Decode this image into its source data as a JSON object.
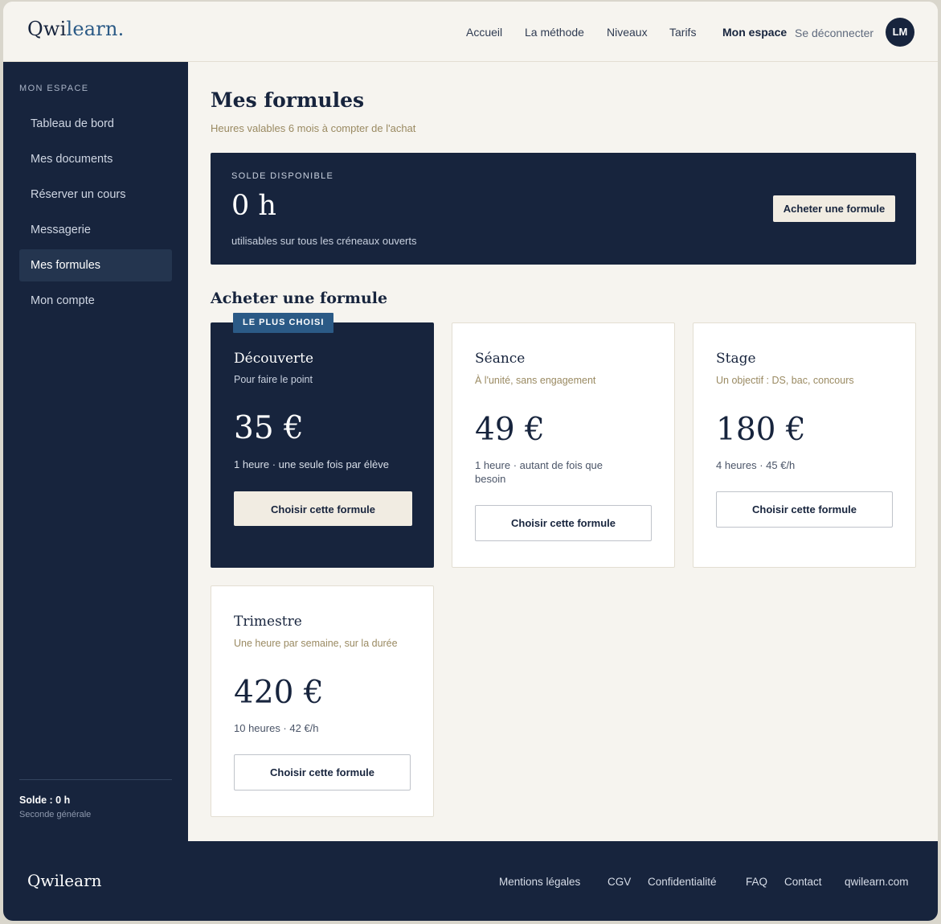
{
  "brand": {
    "logo_main": "Qwi",
    "logo_accent": "learn.",
    "footer_logo": "Qwilearn"
  },
  "colors": {
    "navy": "#17243d",
    "accent_blue": "#2b5a86",
    "cream": "#f6f4ef",
    "gold_text": "#9a8a62"
  },
  "nav": {
    "links": [
      "Accueil",
      "La méthode",
      "Niveaux",
      "Tarifs"
    ],
    "current": "Mon espace",
    "logout": "Se déconnecter",
    "avatar_initials": "LM"
  },
  "sidebar": {
    "heading": "MON ESPACE",
    "items": [
      {
        "label": "Tableau de bord",
        "active": false
      },
      {
        "label": "Mes documents",
        "active": false
      },
      {
        "label": "Réserver un cours",
        "active": false
      },
      {
        "label": "Messagerie",
        "active": false
      },
      {
        "label": "Mes formules",
        "active": true
      },
      {
        "label": "Mon compte",
        "active": false
      }
    ],
    "balance": "Solde : 0 h",
    "level": "Seconde générale"
  },
  "main": {
    "title": "Mes formules",
    "subtitle": "Heures valables 6 mois à compter de l'achat",
    "balance_card": {
      "label": "SOLDE DISPONIBLE",
      "value": "0 h",
      "note": "utilisables sur tous les créneaux ouverts",
      "button": "Acheter une formule"
    },
    "section_title": "Acheter une formule",
    "plans": [
      {
        "badge": "LE PLUS CHOISI",
        "name": "Découverte",
        "tagline": "Pour faire le point",
        "price": "35 €",
        "detail": "1 heure · une seule fois par élève",
        "button": "Choisir cette formule",
        "featured": true
      },
      {
        "name": "Séance",
        "tagline": "À l'unité, sans engagement",
        "price": "49 €",
        "detail": "1 heure · autant de fois que besoin",
        "button": "Choisir cette formule",
        "featured": false
      },
      {
        "name": "Stage",
        "tagline": "Un objectif : DS, bac, concours",
        "price": "180 €",
        "detail": "4 heures · 45 €/h",
        "button": "Choisir cette formule",
        "featured": false
      },
      {
        "name": "Trimestre",
        "tagline": "Une heure par semaine, sur la durée",
        "price": "420 €",
        "detail": "10 heures · 42 €/h",
        "button": "Choisir cette formule",
        "featured": false
      }
    ]
  },
  "footer": {
    "links": [
      "Mentions légales",
      "CGV",
      "Confidentialité",
      "FAQ",
      "Contact",
      "qwilearn.com"
    ]
  }
}
